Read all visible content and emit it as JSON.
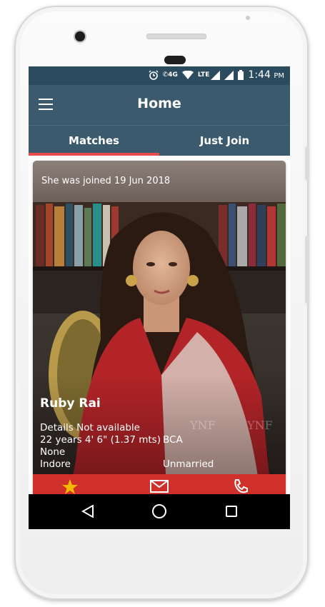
{
  "status_bar": {
    "time": "1:44",
    "time_suffix": "PM",
    "network_4g": "4G",
    "network_lte": "LTE",
    "icons": [
      "alarm-icon",
      "phone-4g-icon",
      "wifi-icon",
      "lte-signal-icon",
      "signal-icon",
      "battery-icon"
    ]
  },
  "app_bar": {
    "title": "Home",
    "menu_icon": "hamburger-menu-icon"
  },
  "tabs": [
    {
      "label": "Matches",
      "selected": true
    },
    {
      "label": "Just Join",
      "selected": false
    }
  ],
  "card": {
    "joined_text": "She was joined 19 Jun 2018",
    "name": "Ruby Rai",
    "details_line1": "Details Not available",
    "details_line2_left": "22 years 4' 6\" (1.37 mts)",
    "details_line2_right": "BCA",
    "details_line3": "None",
    "details_line4_left": "Indore",
    "details_line4_right": "Unmarried",
    "watermark": "YNF"
  },
  "card_actions": [
    "star-icon",
    "mail-icon",
    "phone-icon"
  ],
  "nav_bar": [
    "back-icon",
    "home-icon",
    "recent-apps-icon"
  ],
  "colors": {
    "status_bar": "#2c4b5f",
    "app_bar": "#3b5a6d",
    "tab_indicator": "#e74c4c",
    "action_bar": "#d0302a",
    "star": "#f5b800"
  }
}
